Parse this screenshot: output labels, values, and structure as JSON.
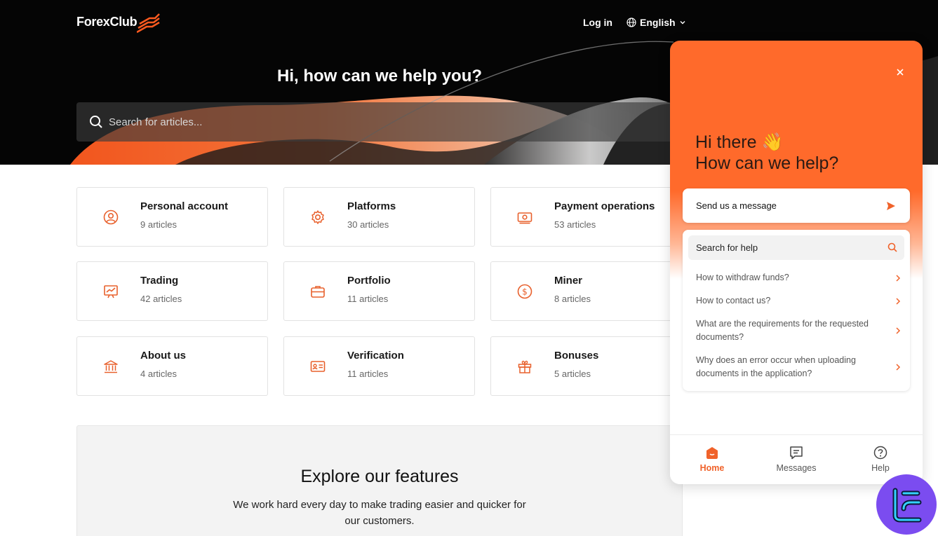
{
  "brand": {
    "name": "ForexClub",
    "accent": "#ff6a2b"
  },
  "nav": {
    "login": "Log in",
    "language": "English"
  },
  "hero": {
    "title": "Hi, how can we help you?",
    "search_placeholder": "Search for articles..."
  },
  "categories": [
    {
      "title": "Personal account",
      "count": "9 articles",
      "icon": "user-circle-icon"
    },
    {
      "title": "Platforms",
      "count": "30 articles",
      "icon": "gear-icon"
    },
    {
      "title": "Payment operations",
      "count": "53 articles",
      "icon": "money-icon"
    },
    {
      "title": "Trading",
      "count": "42 articles",
      "icon": "chart-board-icon"
    },
    {
      "title": "Portfolio",
      "count": "11 articles",
      "icon": "briefcase-icon"
    },
    {
      "title": "Miner",
      "count": "8 articles",
      "icon": "dollar-coin-icon"
    },
    {
      "title": "About us",
      "count": "4 articles",
      "icon": "bank-icon"
    },
    {
      "title": "Verification",
      "count": "11 articles",
      "icon": "id-card-icon"
    },
    {
      "title": "Bonuses",
      "count": "5 articles",
      "icon": "gift-icon"
    }
  ],
  "features": {
    "title": "Explore our features",
    "text": "We work hard every day to make trading easier and quicker for our customers."
  },
  "widget": {
    "greeting_line1": "Hi there 👋",
    "greeting_line2": "How can we help?",
    "send_message": "Send us a message",
    "search_help": "Search for help",
    "faqs": [
      "How to withdraw funds?",
      "How to contact us?",
      "What are the requirements for the requested documents?",
      "Why does an error occur when uploading documents in the application?"
    ],
    "tabs": [
      "Home",
      "Messages",
      "Help"
    ]
  }
}
